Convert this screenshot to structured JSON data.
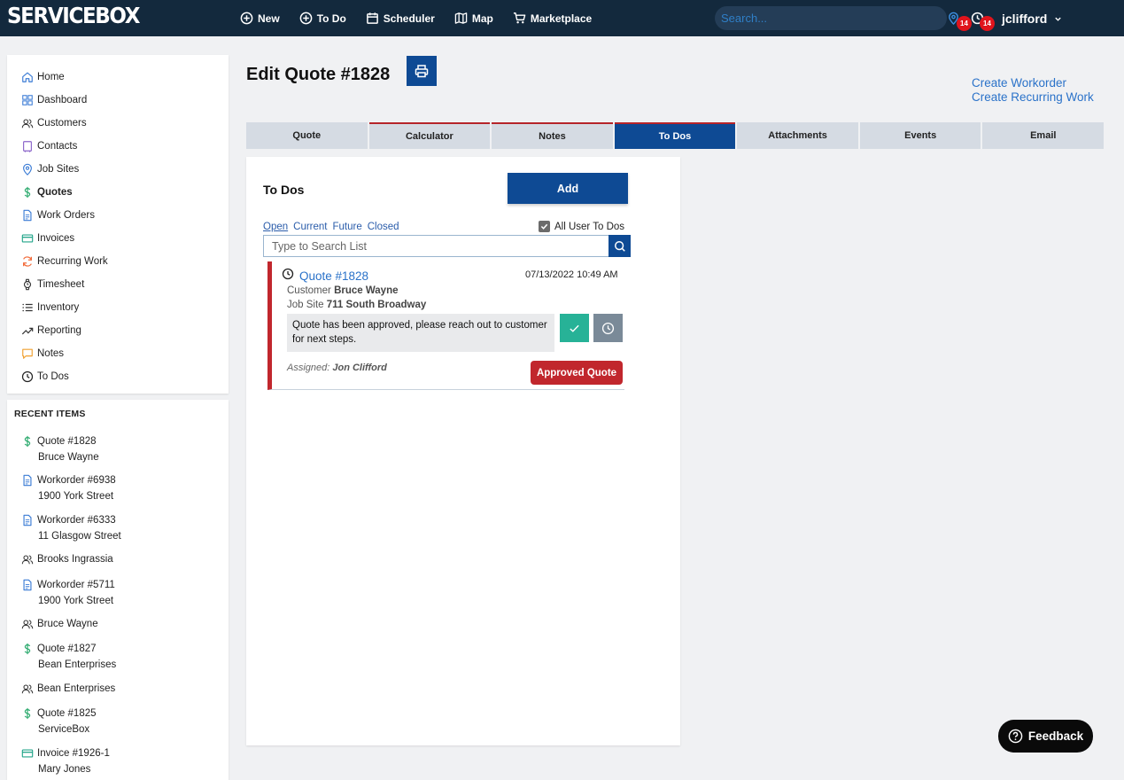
{
  "app": {
    "logo": "SERVICEBOX"
  },
  "topnav": {
    "items": [
      {
        "label": "New",
        "icon": "plus-circle-icon"
      },
      {
        "label": "To Do",
        "icon": "plus-circle-icon"
      },
      {
        "label": "Scheduler",
        "icon": "calendar-icon"
      },
      {
        "label": "Map",
        "icon": "map-icon"
      },
      {
        "label": "Marketplace",
        "icon": "cart-icon"
      }
    ],
    "search_placeholder": "Search...",
    "location_badge": "14",
    "clock_badge": "14",
    "username": "jclifford"
  },
  "sidebar": {
    "items": [
      {
        "label": "Home",
        "icon": "home-icon"
      },
      {
        "label": "Dashboard",
        "icon": "grid-icon"
      },
      {
        "label": "Customers",
        "icon": "users-icon"
      },
      {
        "label": "Contacts",
        "icon": "contact-book-icon"
      },
      {
        "label": "Job Sites",
        "icon": "map-pin-icon"
      },
      {
        "label": "Quotes",
        "icon": "dollar-icon",
        "active": true
      },
      {
        "label": "Work Orders",
        "icon": "document-icon"
      },
      {
        "label": "Invoices",
        "icon": "credit-card-icon"
      },
      {
        "label": "Recurring Work",
        "icon": "refresh-icon"
      },
      {
        "label": "Timesheet",
        "icon": "watch-icon"
      },
      {
        "label": "Inventory",
        "icon": "list-icon"
      },
      {
        "label": "Reporting",
        "icon": "trending-icon"
      },
      {
        "label": "Notes",
        "icon": "chat-icon"
      },
      {
        "label": "To Dos",
        "icon": "clock-icon"
      }
    ]
  },
  "recent": {
    "heading": "RECENT ITEMS",
    "items": [
      {
        "title": "Quote #1828",
        "sub": "Bruce Wayne",
        "icon": "dollar-icon"
      },
      {
        "title": "Workorder #6938",
        "sub": "1900 York Street",
        "icon": "document-icon"
      },
      {
        "title": "Workorder #6333",
        "sub": "11 Glasgow Street",
        "icon": "document-icon"
      },
      {
        "title": "Brooks Ingrassia",
        "sub": "",
        "icon": "users-icon"
      },
      {
        "title": "Workorder #5711",
        "sub": "1900 York Street",
        "icon": "document-icon"
      },
      {
        "title": "Bruce Wayne",
        "sub": "",
        "icon": "users-icon"
      },
      {
        "title": "Quote #1827",
        "sub": "Bean Enterprises",
        "icon": "dollar-icon"
      },
      {
        "title": "Bean Enterprises",
        "sub": "",
        "icon": "users-icon"
      },
      {
        "title": "Quote #1825",
        "sub": "ServiceBox",
        "icon": "dollar-icon"
      },
      {
        "title": "Invoice #1926-1",
        "sub": "Mary Jones",
        "icon": "credit-card-icon"
      }
    ]
  },
  "header": {
    "title": "Edit Quote #1828",
    "create_workorder": "Create Workorder",
    "create_recurring": "Create Recurring Work"
  },
  "tabs": [
    {
      "label": "Quote"
    },
    {
      "label": "Calculator"
    },
    {
      "label": "Notes"
    },
    {
      "label": "To Dos",
      "active": true
    },
    {
      "label": "Attachments"
    },
    {
      "label": "Events"
    },
    {
      "label": "Email"
    }
  ],
  "todos": {
    "title": "To Dos",
    "add_label": "Add",
    "filters": [
      "Open",
      "Current",
      "Future",
      "Closed"
    ],
    "active_filter": "Open",
    "all_users_label": "All User To Dos",
    "all_users_checked": true,
    "search_placeholder": "Type to Search List",
    "items": [
      {
        "link": "Quote #1828",
        "date": "07/13/2022 10:49 AM",
        "customer_label": "Customer",
        "customer": "Bruce Wayne",
        "jobsite_label": "Job Site",
        "jobsite": "711 South Broadway",
        "message": "Quote has been approved, please reach out to customer for next steps.",
        "assigned_label": "Assigned:",
        "assigned": "Jon Clifford",
        "tag": "Approved Quote"
      }
    ]
  },
  "feedback": {
    "label": "Feedback"
  },
  "colors": {
    "topbar": "#13293d",
    "primary": "#0e4a94",
    "accent_red": "#c1272d",
    "success": "#27b297",
    "link": "#2a72c9"
  }
}
